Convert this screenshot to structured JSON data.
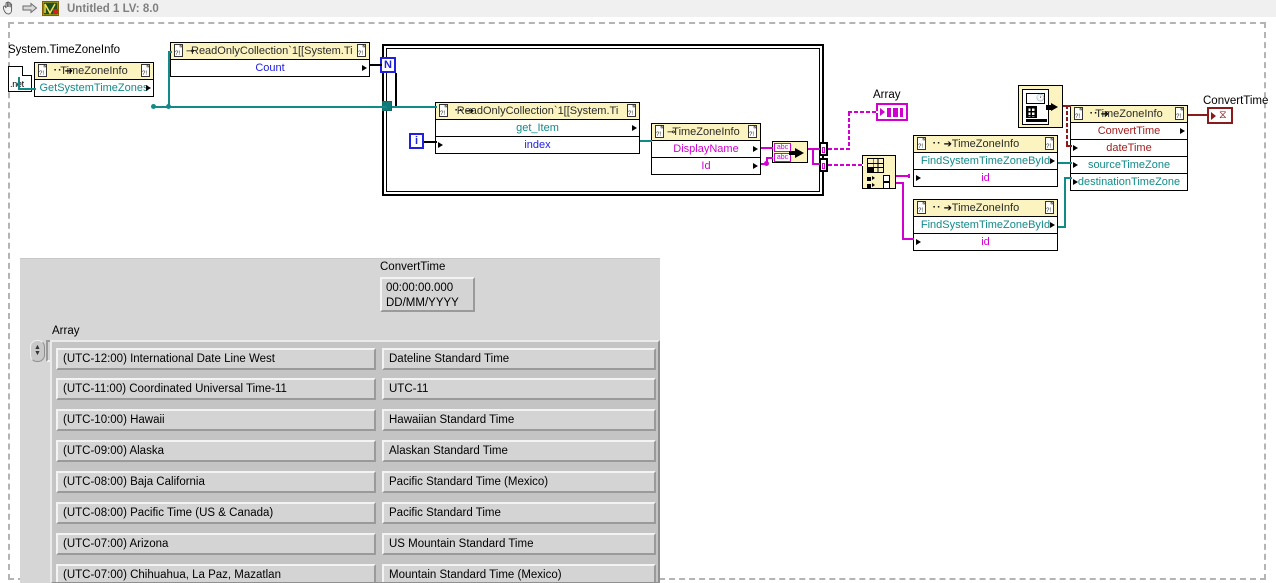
{
  "titlebar": {
    "title": "Untitled 1 LV: 8.0",
    "icons": [
      "hand-cursor-icon",
      "run-arrow-icon",
      "labview-icon"
    ]
  },
  "diagram": {
    "net_constant": {
      "label": "System.TimeZoneInfo",
      "glyph": ".net"
    },
    "nodes": [
      {
        "id": "get-system-timezones",
        "class": "TimeZoneInfo",
        "members": [
          {
            "label": "GetSystemTimeZones",
            "kind": "method-output"
          }
        ]
      },
      {
        "id": "collection-count",
        "class": "ReadOnlyCollection`1[[System.Ti",
        "members": [
          {
            "label": "Count",
            "kind": "property-output"
          }
        ]
      },
      {
        "id": "collection-get-item",
        "class": "ReadOnlyCollection`1[[System.Ti",
        "members": [
          {
            "label": "get_Item",
            "kind": "method-output"
          },
          {
            "label": "index",
            "kind": "input"
          }
        ]
      },
      {
        "id": "timezoneinfo-props",
        "class": "TimeZoneInfo",
        "members": [
          {
            "label": "DisplayName",
            "kind": "property-output"
          },
          {
            "label": "Id",
            "kind": "property-output"
          }
        ]
      },
      {
        "id": "find-tz-source",
        "class": "TimeZoneInfo",
        "members": [
          {
            "label": "FindSystemTimeZoneById",
            "kind": "method-output"
          },
          {
            "label": "id",
            "kind": "input"
          }
        ]
      },
      {
        "id": "find-tz-destination",
        "class": "TimeZoneInfo",
        "members": [
          {
            "label": "FindSystemTimeZoneById",
            "kind": "method-output"
          },
          {
            "label": "id",
            "kind": "input"
          }
        ]
      },
      {
        "id": "convert-time",
        "class": "TimeZoneInfo",
        "members": [
          {
            "label": "ConvertTime",
            "kind": "method-output"
          },
          {
            "label": "dateTime",
            "kind": "input"
          },
          {
            "label": "sourceTimeZone",
            "kind": "input"
          },
          {
            "label": "destinationTimeZone",
            "kind": "input"
          }
        ]
      }
    ],
    "loop": {
      "count_terminal": "N",
      "iteration_terminal": "i"
    },
    "indicators": [
      {
        "name": "array-indicator",
        "label": "Array"
      },
      {
        "name": "converttime-indicator",
        "label": "ConvertTime"
      }
    ],
    "functions": [
      {
        "name": "build-array"
      },
      {
        "name": "index-array"
      },
      {
        "name": "get-date-time-in-seconds"
      }
    ],
    "wire_colors": {
      "dotnet_refnum": "#128a8a",
      "integer": "#000000",
      "string": "#d000d0",
      "timestamp": "#8b1a1a"
    }
  },
  "panel": {
    "converttime": {
      "label": "ConvertTime",
      "time": "00:00:00.000",
      "date": "DD/MM/YYYY"
    },
    "array": {
      "label": "Array",
      "index": "0",
      "rows": [
        {
          "display_name": "(UTC-12:00) International Date Line West",
          "id": "Dateline Standard Time"
        },
        {
          "display_name": "(UTC-11:00) Coordinated Universal Time-11",
          "id": "UTC-11"
        },
        {
          "display_name": "(UTC-10:00) Hawaii",
          "id": "Hawaiian Standard Time"
        },
        {
          "display_name": "(UTC-09:00) Alaska",
          "id": "Alaskan Standard Time"
        },
        {
          "display_name": "(UTC-08:00) Baja California",
          "id": "Pacific Standard Time (Mexico)"
        },
        {
          "display_name": "(UTC-08:00) Pacific Time (US & Canada)",
          "id": "Pacific Standard Time"
        },
        {
          "display_name": "(UTC-07:00) Arizona",
          "id": "US Mountain Standard Time"
        },
        {
          "display_name": "(UTC-07:00) Chihuahua, La Paz, Mazatlan",
          "id": "Mountain Standard Time (Mexico)"
        }
      ]
    }
  }
}
